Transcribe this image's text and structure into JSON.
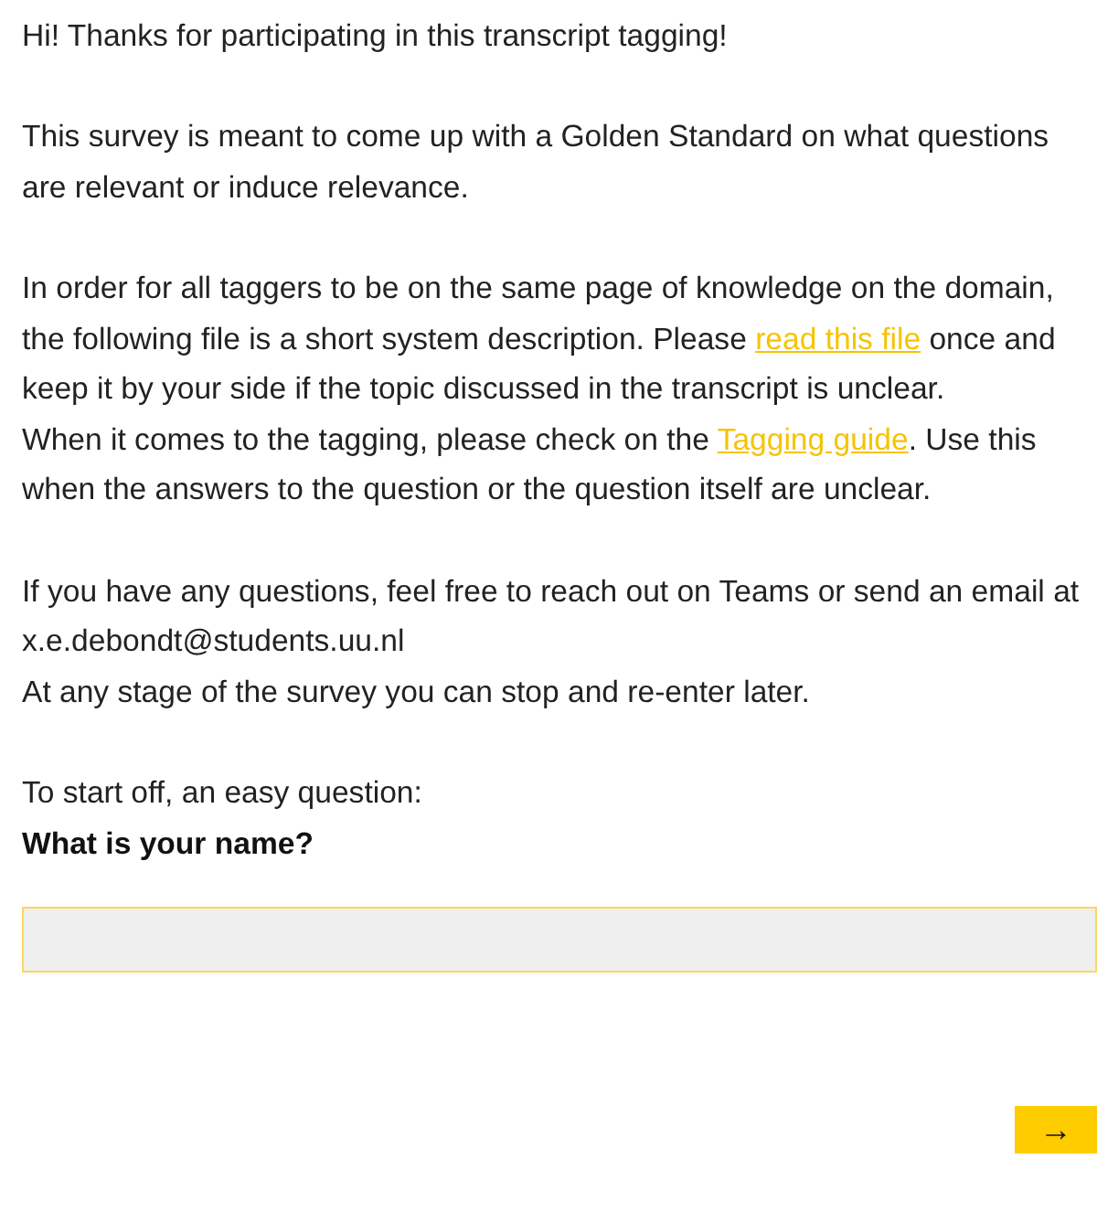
{
  "blocks": [
    {
      "kind": "paragraph",
      "lines": [
        [
          {
            "text": "Hi! Thanks for participating in this transcript tagging!",
            "kind": "text"
          }
        ]
      ]
    },
    {
      "kind": "paragraph",
      "lines": [
        [
          {
            "text": "This survey is meant to come up with a Golden Standard on what questions are relevant or induce relevance.",
            "kind": "text"
          }
        ]
      ]
    },
    {
      "kind": "paragraph",
      "lines": [
        [
          {
            "text": "In order for all taggers to be on the same page of knowledge on the domain, the following file is a short system description. Please ",
            "kind": "text"
          },
          {
            "text": "read this file",
            "kind": "link"
          },
          {
            "text": " once and keep it by your side if the topic discussed in the transcript is unclear.",
            "kind": "text"
          }
        ],
        [
          {
            "text": "When it comes to the tagging, please check on the ",
            "kind": "text"
          },
          {
            "text": "Tagging guide",
            "kind": "link"
          },
          {
            "text": ". Use this when the answers to the question or the question itself are unclear.",
            "kind": "text"
          }
        ]
      ]
    },
    {
      "kind": "paragraph",
      "lines": [
        [
          {
            "text": "If you have any questions, feel free to reach out on Teams or send an email at x.e.debondt@students.uu.nl",
            "kind": "text"
          }
        ],
        [
          {
            "text": "At any stage of the survey you can stop and re-enter later.",
            "kind": "text"
          }
        ]
      ]
    },
    {
      "kind": "paragraph",
      "lines": [
        [
          {
            "text": "To start off, an easy question:",
            "kind": "text"
          }
        ]
      ]
    },
    {
      "kind": "question",
      "text": "What is your name?"
    }
  ],
  "next_button": "→"
}
